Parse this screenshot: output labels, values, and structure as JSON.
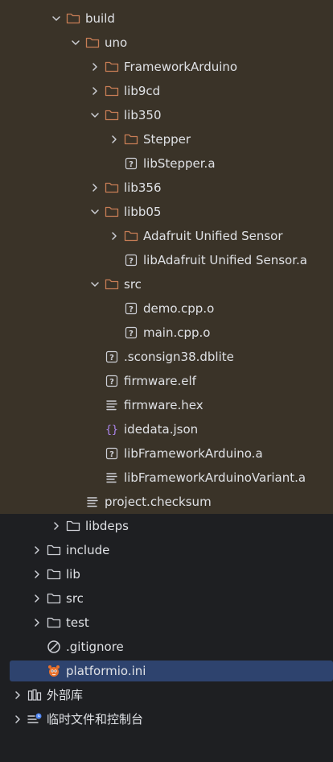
{
  "tree": [
    {
      "label": "build",
      "depth": 2,
      "chevron": "down",
      "icon": "folder-icon",
      "highlight": true
    },
    {
      "label": "uno",
      "depth": 3,
      "chevron": "down",
      "icon": "folder-icon",
      "highlight": true
    },
    {
      "label": "FrameworkArduino",
      "depth": 4,
      "chevron": "right",
      "icon": "folder-icon",
      "highlight": true
    },
    {
      "label": "lib9cd",
      "depth": 4,
      "chevron": "right",
      "icon": "folder-icon",
      "highlight": true
    },
    {
      "label": "lib350",
      "depth": 4,
      "chevron": "down",
      "icon": "folder-icon",
      "highlight": true
    },
    {
      "label": "Stepper",
      "depth": 5,
      "chevron": "right",
      "icon": "folder-icon",
      "highlight": true
    },
    {
      "label": "libStepper.a",
      "depth": 5,
      "chevron": "none",
      "icon": "unknown-file-icon",
      "highlight": true
    },
    {
      "label": "lib356",
      "depth": 4,
      "chevron": "right",
      "icon": "folder-icon",
      "highlight": true
    },
    {
      "label": "libb05",
      "depth": 4,
      "chevron": "down",
      "icon": "folder-icon",
      "highlight": true
    },
    {
      "label": "Adafruit Unified Sensor",
      "depth": 5,
      "chevron": "right",
      "icon": "folder-icon",
      "highlight": true
    },
    {
      "label": "libAdafruit Unified Sensor.a",
      "depth": 5,
      "chevron": "none",
      "icon": "unknown-file-icon",
      "highlight": true
    },
    {
      "label": "src",
      "depth": 4,
      "chevron": "down",
      "icon": "folder-icon",
      "highlight": true
    },
    {
      "label": "demo.cpp.o",
      "depth": 5,
      "chevron": "none",
      "icon": "unknown-file-icon",
      "highlight": true
    },
    {
      "label": "main.cpp.o",
      "depth": 5,
      "chevron": "none",
      "icon": "unknown-file-icon",
      "highlight": true
    },
    {
      "label": ".sconsign38.dblite",
      "depth": 4,
      "chevron": "none",
      "icon": "unknown-file-icon",
      "highlight": true
    },
    {
      "label": "firmware.elf",
      "depth": 4,
      "chevron": "none",
      "icon": "unknown-file-icon",
      "highlight": true
    },
    {
      "label": "firmware.hex",
      "depth": 4,
      "chevron": "none",
      "icon": "text-file-icon",
      "highlight": true
    },
    {
      "label": "idedata.json",
      "depth": 4,
      "chevron": "none",
      "icon": "json-file-icon",
      "highlight": true
    },
    {
      "label": "libFrameworkArduino.a",
      "depth": 4,
      "chevron": "none",
      "icon": "unknown-file-icon",
      "highlight": true
    },
    {
      "label": "libFrameworkArduinoVariant.a",
      "depth": 4,
      "chevron": "none",
      "icon": "text-file-icon",
      "highlight": true
    },
    {
      "label": "project.checksum",
      "depth": 3,
      "chevron": "none",
      "icon": "text-file-icon",
      "highlight": true
    },
    {
      "label": "libdeps",
      "depth": 2,
      "chevron": "right",
      "icon": "folder-gray-icon",
      "highlight": false
    },
    {
      "label": "include",
      "depth": 1,
      "chevron": "right",
      "icon": "folder-gray-icon",
      "highlight": false
    },
    {
      "label": "lib",
      "depth": 1,
      "chevron": "right",
      "icon": "folder-gray-icon",
      "highlight": false
    },
    {
      "label": "src",
      "depth": 1,
      "chevron": "right",
      "icon": "folder-gray-icon",
      "highlight": false
    },
    {
      "label": "test",
      "depth": 1,
      "chevron": "right",
      "icon": "folder-gray-icon",
      "highlight": false
    },
    {
      "label": ".gitignore",
      "depth": 1,
      "chevron": "none",
      "icon": "gitignore-icon",
      "highlight": false
    },
    {
      "label": "platformio.ini",
      "depth": 1,
      "chevron": "none",
      "icon": "platformio-icon",
      "highlight": false,
      "selected": true
    },
    {
      "label": "外部库",
      "depth": 0,
      "chevron": "right",
      "icon": "external-libraries-icon",
      "highlight": false
    },
    {
      "label": "临时文件和控制台",
      "depth": 0,
      "chevron": "right",
      "icon": "scratches-consoles-icon",
      "highlight": false
    }
  ],
  "colors": {
    "background": "#1e1f22",
    "build_band": "#3a3328",
    "selection": "#2e436e",
    "text": "#dfe1e5",
    "folder_orange": "#c77d55",
    "icon_gray": "#ced0d6",
    "json_braces": "#b189f5",
    "platformio_orange": "#e8712c"
  }
}
